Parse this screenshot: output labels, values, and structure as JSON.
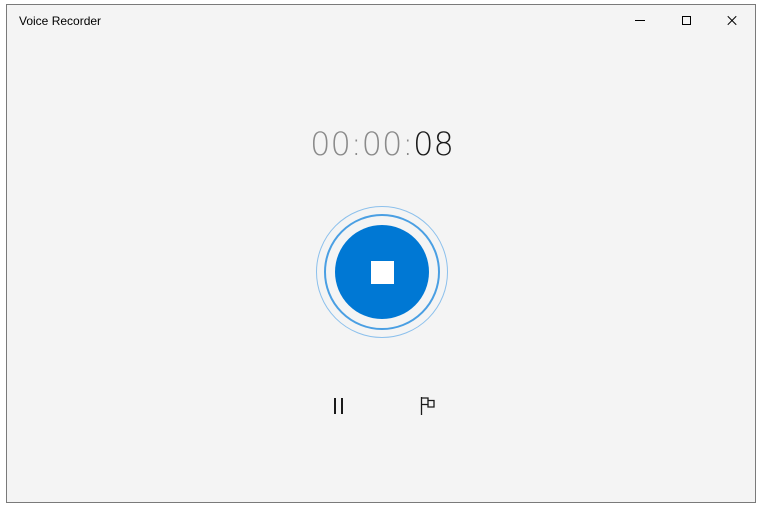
{
  "window": {
    "title": "Voice Recorder",
    "controls": {
      "minimize_icon": "minimize-icon",
      "maximize_icon": "maximize-icon",
      "close_icon": "close-icon"
    }
  },
  "timer": {
    "hours": "00",
    "sep1": ":",
    "minutes": "00",
    "sep2": ":",
    "seconds": "08"
  },
  "recording": {
    "state": "recording",
    "stop_icon": "stop-icon",
    "pause_icon": "pause-icon",
    "marker_icon": "flag-icon"
  },
  "colors": {
    "accent": "#0078d4",
    "ring_inner": "#4a9fe3",
    "ring_outer": "#8cc0ec",
    "background": "#f4f4f4",
    "timer_dim": "#8a8a8a",
    "timer_active": "#1a1a1a"
  }
}
